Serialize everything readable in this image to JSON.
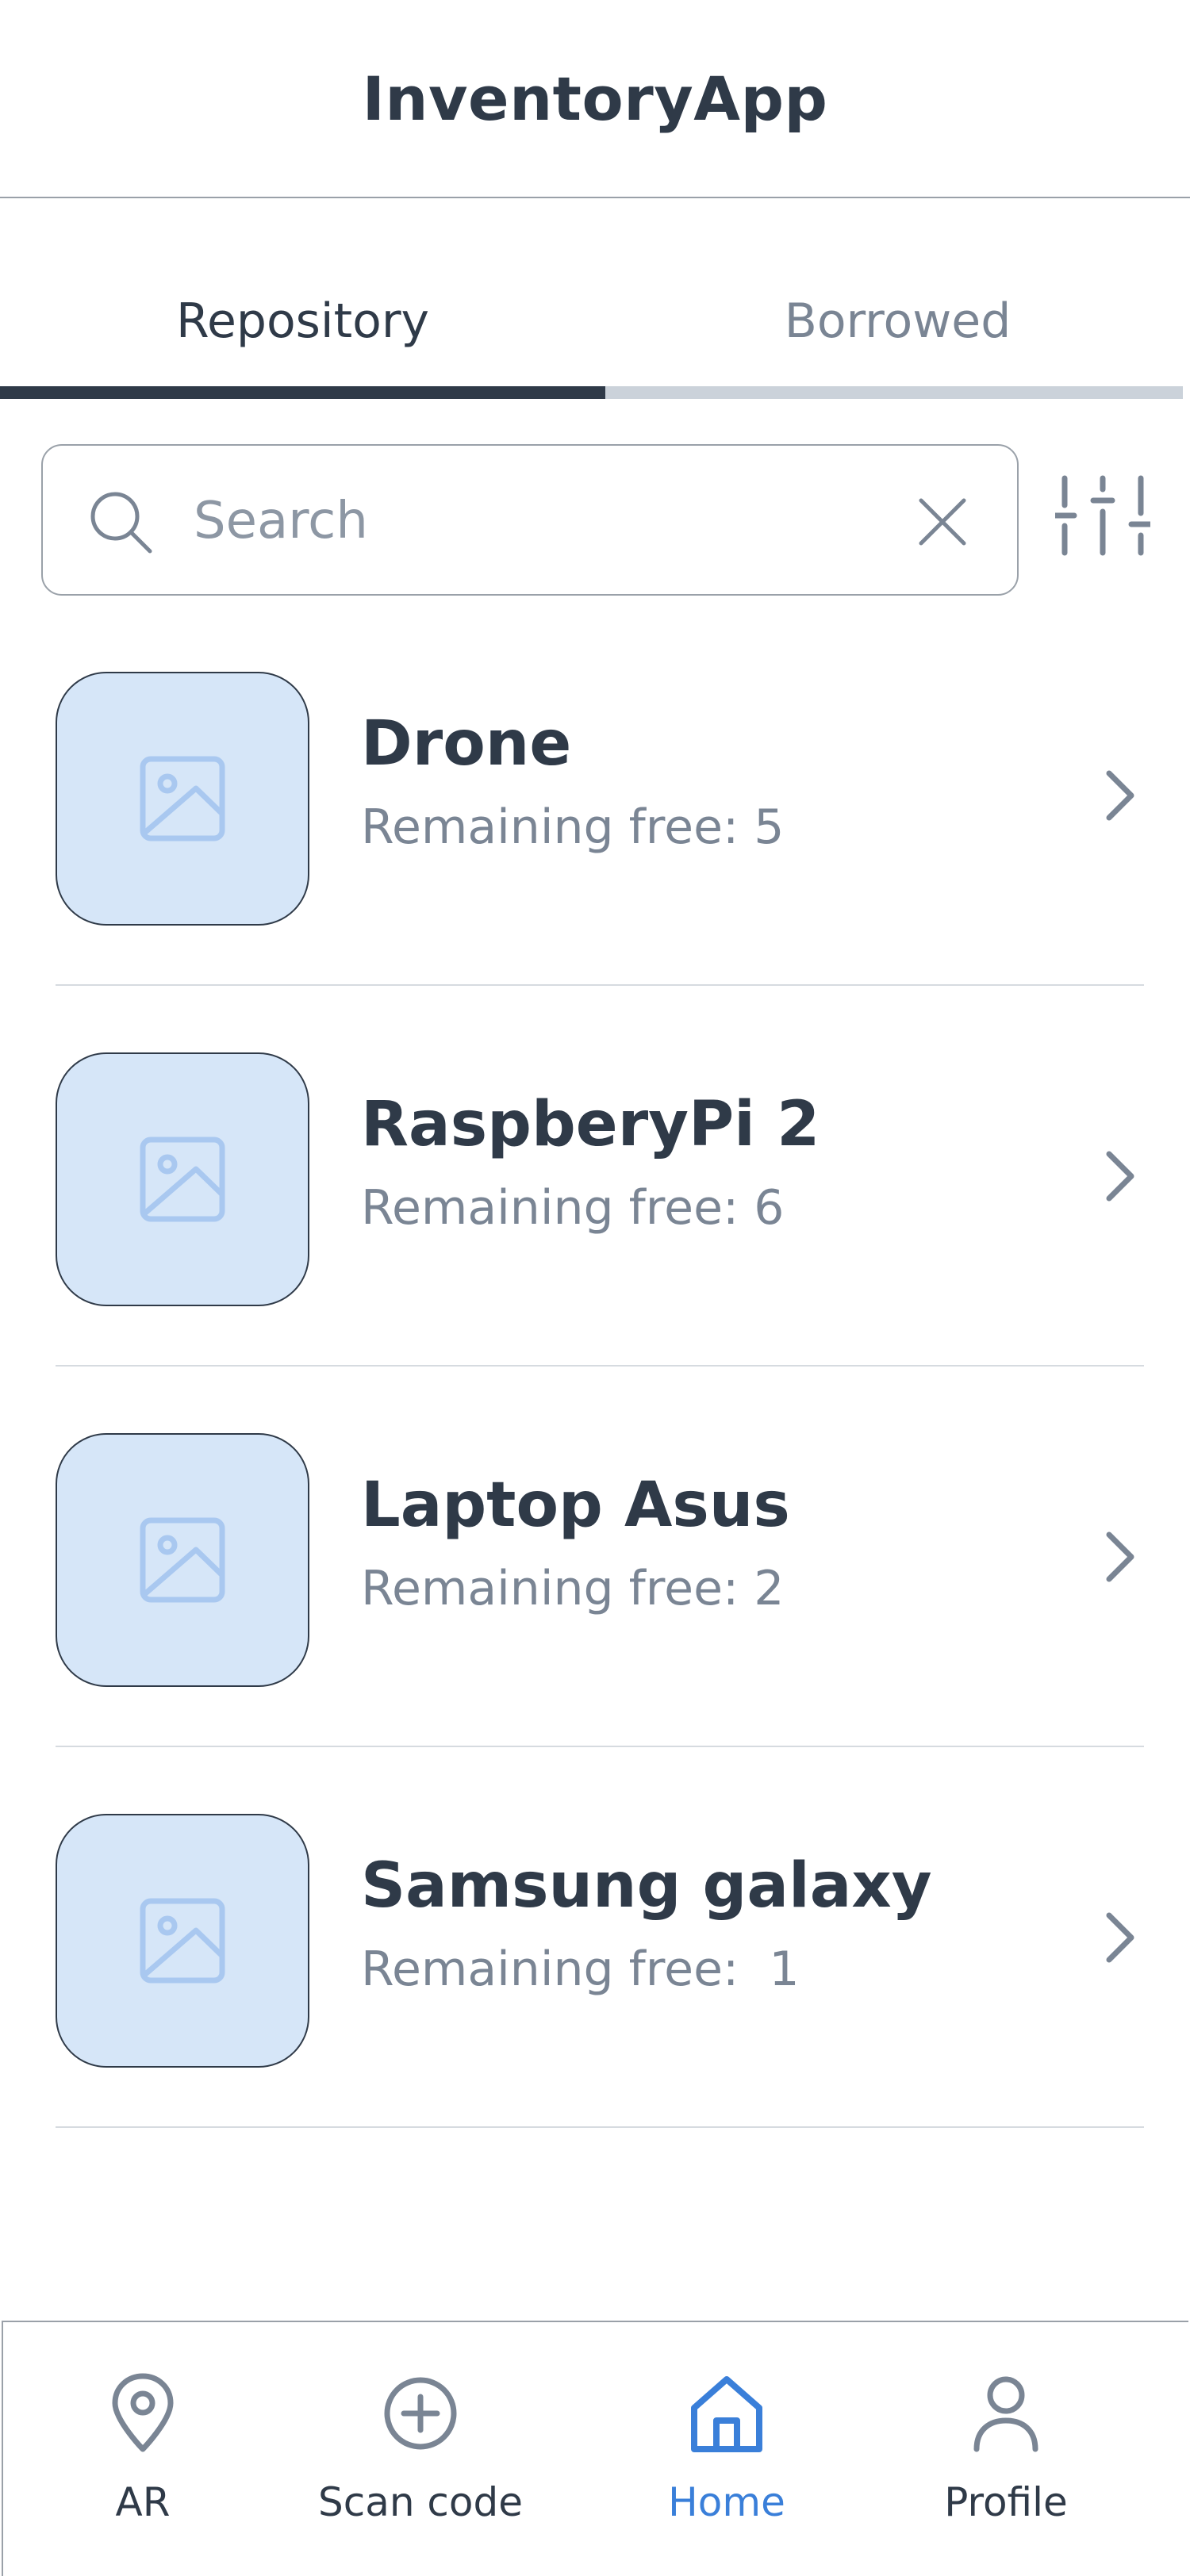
{
  "app": {
    "title": "InventoryApp"
  },
  "tabs": [
    {
      "label": "Repository",
      "active": true
    },
    {
      "label": "Borrowed",
      "active": false
    }
  ],
  "search": {
    "placeholder": "Search",
    "value": ""
  },
  "items": [
    {
      "name": "Drone",
      "subtitle": "Remaining free: 5"
    },
    {
      "name": "RaspberyPi 2",
      "subtitle": "Remaining free: 6"
    },
    {
      "name": "Laptop Asus",
      "subtitle": "Remaining free: 2"
    },
    {
      "name": "Samsung galaxy",
      "subtitle": "Remaining free:  1"
    }
  ],
  "bottom_nav": [
    {
      "label": "AR",
      "icon": "location-pin-icon",
      "active": false
    },
    {
      "label": "Scan code",
      "icon": "plus-circle-icon",
      "active": false
    },
    {
      "label": "Home",
      "icon": "home-icon",
      "active": true
    },
    {
      "label": "Profile",
      "icon": "user-icon",
      "active": false
    }
  ],
  "colors": {
    "text": "#2f3a48",
    "muted": "#7a8594",
    "accent": "#3a7fd9",
    "thumb_bg": "#d6e6f8",
    "thumb_icon": "#a9c8f0"
  }
}
